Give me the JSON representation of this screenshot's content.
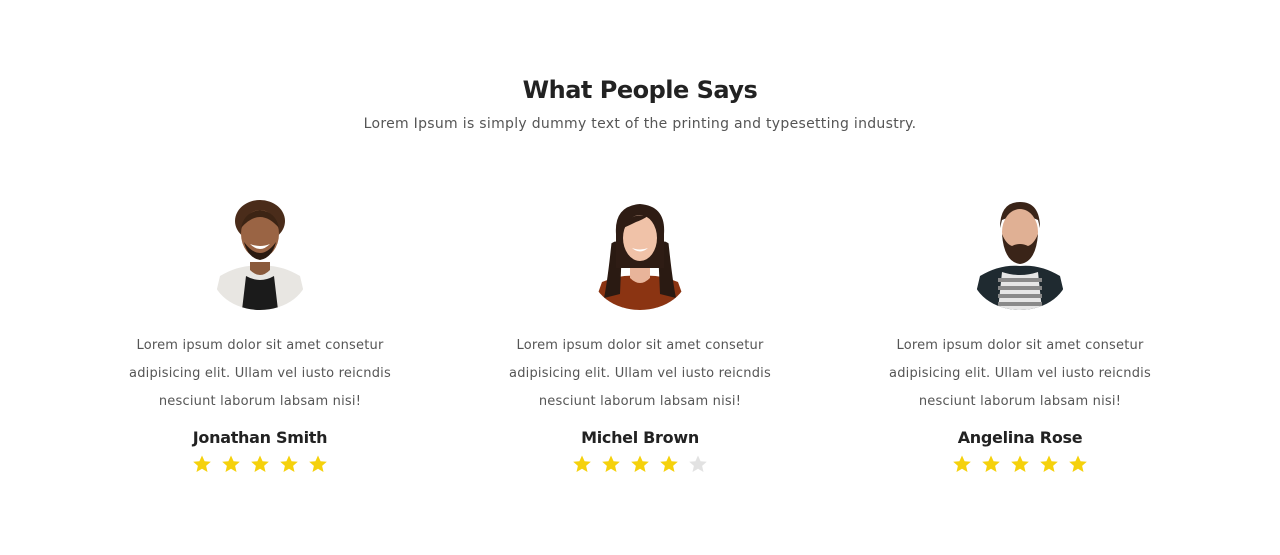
{
  "section": {
    "title": "What People Says",
    "subtitle": "Lorem Ipsum is simply dummy text of the printing and typesetting industry."
  },
  "colors": {
    "star_filled": "#f5d10c",
    "star_empty": "#e2e2e2"
  },
  "testimonials": [
    {
      "name": "Jonathan Smith",
      "quote_lines": [
        "Lorem ipsum dolor sit amet consetur",
        "adipisicing elit. Ullam vel iusto reicndis",
        "nesciunt laborum labsam nisi!"
      ],
      "rating": 5,
      "rating_max": 5,
      "avatar_icon": "avatar-man-afro-icon"
    },
    {
      "name": "Michel Brown",
      "quote_lines": [
        "Lorem ipsum dolor sit amet consetur",
        "adipisicing elit. Ullam vel iusto reicndis",
        "nesciunt laborum labsam nisi!"
      ],
      "rating": 4,
      "rating_max": 5,
      "avatar_icon": "avatar-woman-icon"
    },
    {
      "name": "Angelina Rose",
      "quote_lines": [
        "Lorem ipsum dolor sit amet consetur",
        "adipisicing elit. Ullam vel iusto reicndis",
        "nesciunt laborum labsam nisi!"
      ],
      "rating": 5,
      "rating_max": 5,
      "avatar_icon": "avatar-man-beard-icon"
    }
  ]
}
